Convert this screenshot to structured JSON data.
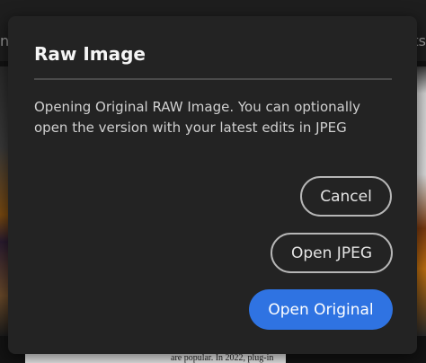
{
  "background": {
    "left_fragment": "ne",
    "right_fragment": "ts",
    "paper_text": "are popular. In 2022, plug-in"
  },
  "dialog": {
    "title": "Raw Image",
    "message": "Opening Original RAW Image. You can optionally open the version with your latest edits in JPEG",
    "buttons": {
      "cancel": "Cancel",
      "open_jpeg": "Open JPEG",
      "open_original": "Open Original"
    }
  },
  "colors": {
    "primary_button": "#2f73e2",
    "dialog_background": "#232323",
    "secondary_button_border": "#b6b6b6"
  }
}
